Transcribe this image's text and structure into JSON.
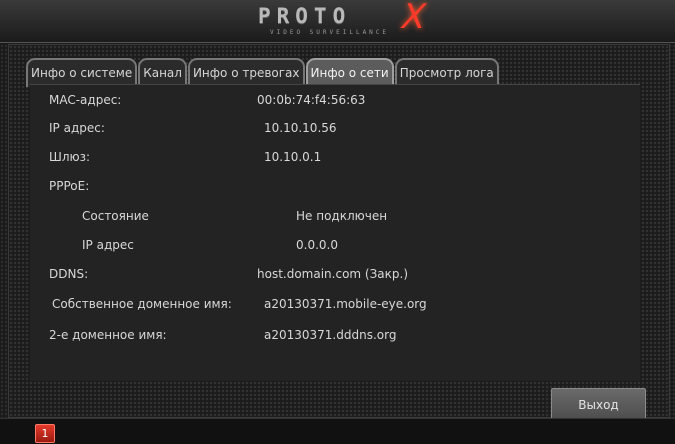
{
  "logo": {
    "main": "PROTO",
    "sub": "VIDEO SURVEILLANCE",
    "x_mark": "X"
  },
  "tabs": [
    {
      "label": "Инфо о системе",
      "active": false
    },
    {
      "label": "Канал",
      "active": false
    },
    {
      "label": "Инфо о тревогах",
      "active": false
    },
    {
      "label": "Инфо о сети",
      "active": true
    },
    {
      "label": "Просмотр лога",
      "active": false
    }
  ],
  "network": {
    "mac_label": "MAC-адрес:",
    "mac_value": "00:0b:74:f4:56:63",
    "ip_label": "IP адрес:",
    "ip_value": "10.10.10.56",
    "gateway_label": "Шлюз:",
    "gateway_value": "10.10.0.1",
    "pppoe_label": "PPPoE:",
    "pppoe_state_label": "Состояние",
    "pppoe_state_value": "Не подключен",
    "pppoe_ip_label": "IP адрес",
    "pppoe_ip_value": "0.0.0.0",
    "ddns_label": "DDNS:",
    "ddns_value": "host.domain.com (Закр.)",
    "own_domain_label": "Собственное доменное имя:",
    "own_domain_value": "a20130371.mobile-eye.org",
    "second_domain_label": "2-е доменное имя:",
    "second_domain_value": "a20130371.dddns.org"
  },
  "buttons": {
    "exit": "Выход"
  },
  "status": {
    "alert_count": "1"
  },
  "colors": {
    "accent_red": "#e43a2a",
    "active_tab": "#5c5c5c"
  }
}
